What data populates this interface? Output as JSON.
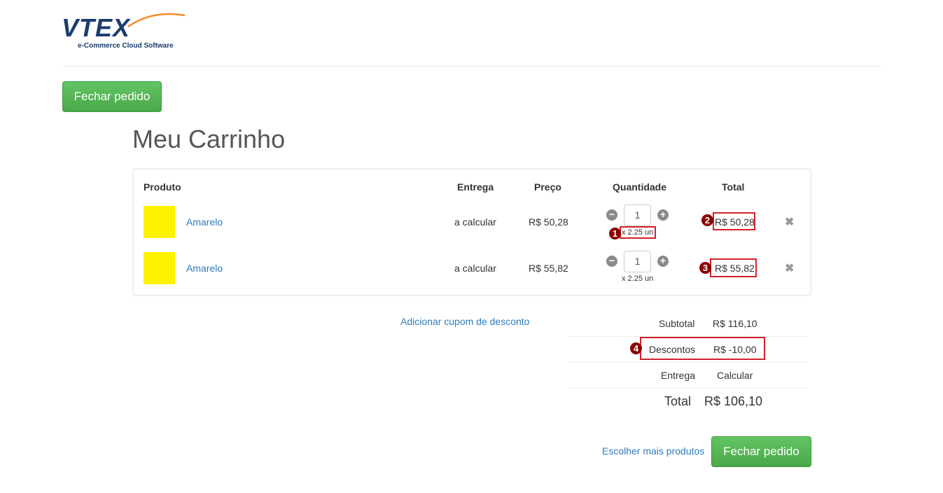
{
  "brand": {
    "name": "VTEX",
    "tagline": "e-Commerce Cloud Software",
    "accent": "#f28c28",
    "color": "#1a3d6e"
  },
  "header": {
    "close_order_label": "Fechar pedido"
  },
  "page": {
    "title": "Meu Carrinho"
  },
  "cart": {
    "columns": {
      "product": "Produto",
      "delivery": "Entrega",
      "price": "Preço",
      "quantity": "Quantidade",
      "total": "Total"
    },
    "items": [
      {
        "name": "Amarelo",
        "delivery": "a calcular",
        "price": "R$ 50,28",
        "quantity": "1",
        "unit": "x 2.25 un",
        "total": "R$ 50,28",
        "thumb_color": "#fff200"
      },
      {
        "name": "Amarelo",
        "delivery": "a calcular",
        "price": "R$ 55,82",
        "quantity": "1",
        "unit": "x 2.25 un",
        "total": "R$ 55,82",
        "thumb_color": "#fff200"
      }
    ]
  },
  "coupon": {
    "label": "Adicionar cupom de desconto"
  },
  "summary": {
    "subtotal_label": "Subtotal",
    "subtotal_value": "R$ 116,10",
    "discount_label": "Descontos",
    "discount_value": "R$ -10,00",
    "shipping_label": "Entrega",
    "shipping_value": "Calcular",
    "total_label": "Total",
    "total_value": "R$ 106,10"
  },
  "footer": {
    "more_products_label": "Escolher mais produtos",
    "close_order_label": "Fechar pedido"
  },
  "annotations": [
    "1",
    "2",
    "3",
    "4"
  ]
}
